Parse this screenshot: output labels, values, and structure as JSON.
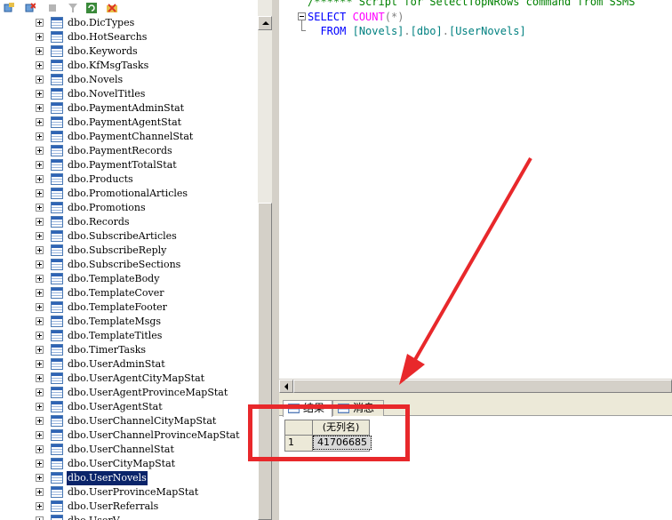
{
  "toolbar": {
    "icons": [
      "connect-icon",
      "disconnect-icon",
      "stop-icon",
      "filter-icon",
      "refresh-icon",
      "collapse-icon"
    ]
  },
  "object_explorer": {
    "tables": [
      "dbo.DicTypes",
      "dbo.HotSearchs",
      "dbo.Keywords",
      "dbo.KfMsgTasks",
      "dbo.Novels",
      "dbo.NovelTitles",
      "dbo.PaymentAdminStat",
      "dbo.PaymentAgentStat",
      "dbo.PaymentChannelStat",
      "dbo.PaymentRecords",
      "dbo.PaymentTotalStat",
      "dbo.Products",
      "dbo.PromotionalArticles",
      "dbo.Promotions",
      "dbo.Records",
      "dbo.SubscribeArticles",
      "dbo.SubscribeReply",
      "dbo.SubscribeSections",
      "dbo.TemplateBody",
      "dbo.TemplateCover",
      "dbo.TemplateFooter",
      "dbo.TemplateMsgs",
      "dbo.TemplateTitles",
      "dbo.TimerTasks",
      "dbo.UserAdminStat",
      "dbo.UserAgentCityMapStat",
      "dbo.UserAgentProvinceMapStat",
      "dbo.UserAgentStat",
      "dbo.UserChannelCityMapStat",
      "dbo.UserChannelProvinceMapStat",
      "dbo.UserChannelStat",
      "dbo.UserCityMapStat",
      "dbo.UserNovels",
      "dbo.UserProvinceMapStat",
      "dbo.UserReferrals",
      "dbo.UserV..."
    ],
    "selected": "dbo.UserNovels"
  },
  "editor": {
    "comment_line": "/****** Script for SelectTopNRows command from SSMS",
    "line1": {
      "select": "SELECT",
      "count": "COUNT",
      "paren_open": "(",
      "star": "*",
      "paren_close": ")"
    },
    "line2": {
      "from": "FROM",
      "db": "[Novels]",
      "dot1": ".",
      "schema": "[dbo]",
      "dot2": ".",
      "table": "[UserNovels]"
    }
  },
  "results": {
    "tabs": [
      {
        "label": "结果",
        "active": true
      },
      {
        "label": "消息",
        "active": false
      }
    ],
    "column_header": "(无列名)",
    "rows": [
      {
        "row_number": "1",
        "value": "41706685"
      }
    ]
  },
  "colors": {
    "annotation": "#e8282b",
    "keyword": "#0000ff",
    "function": "#ff00ff",
    "identifier": "#008080",
    "comment": "#008000",
    "selection": "#0a246a"
  }
}
